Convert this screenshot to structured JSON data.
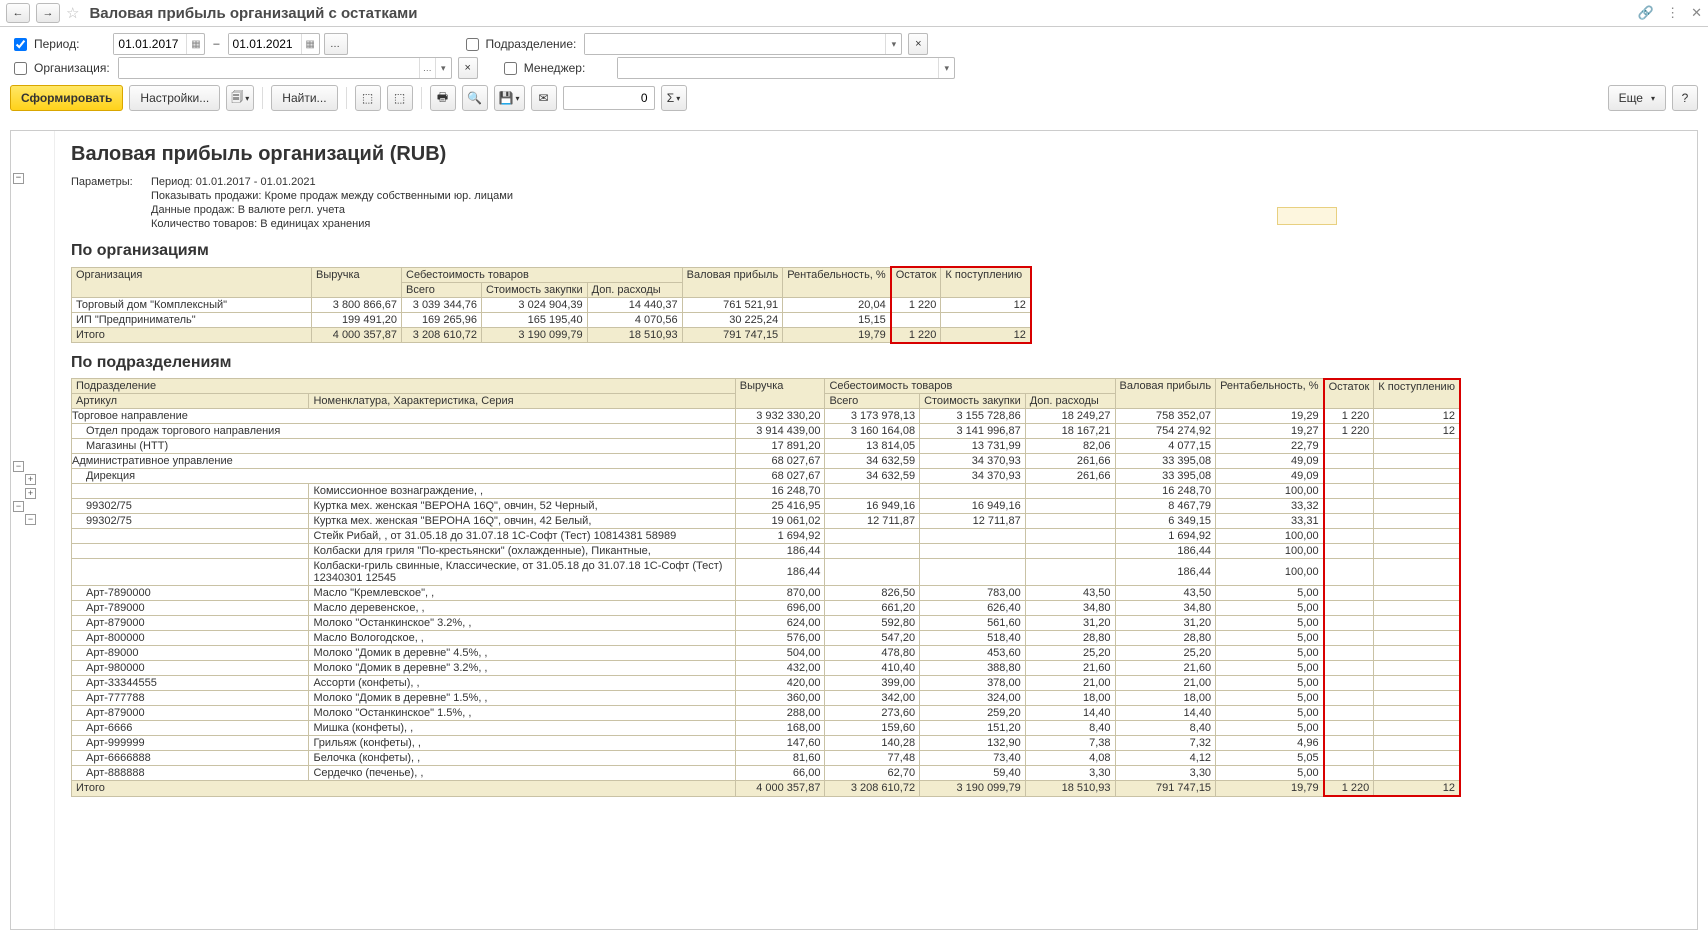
{
  "title": "Валовая прибыль организаций с остатками",
  "filters": {
    "period_label": "Период:",
    "date_from": "01.01.2017",
    "date_to": "01.01.2021",
    "org_label": "Организация:",
    "subdiv_label": "Подразделение:",
    "manager_label": "Менеджер:"
  },
  "toolbar": {
    "form": "Сформировать",
    "settings": "Настройки...",
    "find": "Найти...",
    "more": "Еще",
    "num": "0"
  },
  "report": {
    "title": "Валовая прибыль организаций (RUB)",
    "params_label": "Параметры:",
    "params": [
      "Период: 01.01.2017 - 01.01.2021",
      "Показывать продажи: Кроме продаж между собственными юр. лицами",
      "Данные продаж: В валюте регл. учета",
      "Количество товаров: В единицах хранения"
    ],
    "sec1": "По организациям",
    "sec2": "По подразделениям"
  },
  "t1": {
    "headers": {
      "org": "Организация",
      "rev": "Выручка",
      "cost": "Себестоимость товаров",
      "total": "Всего",
      "purch": "Стоимость закупки",
      "extra": "Доп. расходы",
      "gross": "Валовая прибыль",
      "rent": "Рентабельность, %",
      "stock": "Остаток",
      "incoming": "К поступлению"
    },
    "rows": [
      {
        "org": "Торговый дом \"Комплексный\"",
        "rev": "3 800 866,67",
        "total": "3 039 344,76",
        "purch": "3 024 904,39",
        "extra": "14 440,37",
        "gross": "761 521,91",
        "rent": "20,04",
        "stock": "1 220",
        "inc": "12"
      },
      {
        "org": "ИП \"Предприниматель\"",
        "rev": "199 491,20",
        "total": "169 265,96",
        "purch": "165 195,40",
        "extra": "4 070,56",
        "gross": "30 225,24",
        "rent": "15,15",
        "stock": "",
        "inc": ""
      }
    ],
    "total": {
      "label": "Итого",
      "rev": "4 000 357,87",
      "total": "3 208 610,72",
      "purch": "3 190 099,79",
      "extra": "18 510,93",
      "gross": "791 747,15",
      "rent": "19,79",
      "stock": "1 220",
      "inc": "12"
    }
  },
  "t2": {
    "headers": {
      "subdiv": "Подразделение",
      "art": "Артикул",
      "nom": "Номенклатура, Характеристика, Серия",
      "rev": "Выручка",
      "cost": "Себестоимость товаров",
      "total": "Всего",
      "purch": "Стоимость закупки",
      "extra": "Доп. расходы",
      "gross": "Валовая прибыль",
      "rent": "Рентабельность, %",
      "stock": "Остаток",
      "inc": "К поступлению"
    },
    "rows": [
      {
        "ind": 0,
        "a": "Торговое направление",
        "b": "",
        "r": "3 932 330,20",
        "t": "3 173 978,13",
        "p": "3 155 728,86",
        "e": "18 249,27",
        "g": "758 352,07",
        "n": "19,29",
        "s": "1 220",
        "i": "12"
      },
      {
        "ind": 1,
        "a": "Отдел продаж торгового направления",
        "b": "",
        "r": "3 914 439,00",
        "t": "3 160 164,08",
        "p": "3 141 996,87",
        "e": "18 167,21",
        "g": "754 274,92",
        "n": "19,27",
        "s": "1 220",
        "i": "12"
      },
      {
        "ind": 1,
        "a": "Магазины (НТТ)",
        "b": "",
        "r": "17 891,20",
        "t": "13 814,05",
        "p": "13 731,99",
        "e": "82,06",
        "g": "4 077,15",
        "n": "22,79",
        "s": "",
        "i": ""
      },
      {
        "ind": 0,
        "a": "Административное управление",
        "b": "",
        "r": "68 027,67",
        "t": "34 632,59",
        "p": "34 370,93",
        "e": "261,66",
        "g": "33 395,08",
        "n": "49,09",
        "s": "",
        "i": ""
      },
      {
        "ind": 1,
        "a": "Дирекция",
        "b": "",
        "r": "68 027,67",
        "t": "34 632,59",
        "p": "34 370,93",
        "e": "261,66",
        "g": "33 395,08",
        "n": "49,09",
        "s": "",
        "i": ""
      },
      {
        "ind": 2,
        "a": "",
        "b": "Комиссионное вознаграждение, ,",
        "r": "16 248,70",
        "t": "",
        "p": "",
        "e": "",
        "g": "16 248,70",
        "n": "100,00",
        "s": "",
        "i": ""
      },
      {
        "ind": 2,
        "a": "99302/75",
        "b": "Куртка мех. женская \"ВЕРОНА 16Q\", овчин, 52 Черный,",
        "r": "25 416,95",
        "t": "16 949,16",
        "p": "16 949,16",
        "e": "",
        "g": "8 467,79",
        "n": "33,32",
        "s": "",
        "i": ""
      },
      {
        "ind": 2,
        "a": "99302/75",
        "b": "Куртка мех. женская \"ВЕРОНА 16Q\", овчин, 42 Белый,",
        "r": "19 061,02",
        "t": "12 711,87",
        "p": "12 711,87",
        "e": "",
        "g": "6 349,15",
        "n": "33,31",
        "s": "",
        "i": ""
      },
      {
        "ind": 2,
        "a": "",
        "b": "Стейк Рибай, , от 31.05.18 до 31.07.18 1С-Софт (Тест) 10814381 58989",
        "r": "1 694,92",
        "t": "",
        "p": "",
        "e": "",
        "g": "1 694,92",
        "n": "100,00",
        "s": "",
        "i": ""
      },
      {
        "ind": 2,
        "a": "",
        "b": "Колбаски для гриля \"По-крестьянски\" (охлажденные), Пикантные,",
        "r": "186,44",
        "t": "",
        "p": "",
        "e": "",
        "g": "186,44",
        "n": "100,00",
        "s": "",
        "i": ""
      },
      {
        "ind": 2,
        "a": "",
        "b": "Колбаски-гриль свинные, Классические, от 31.05.18 до 31.07.18 1С-Софт (Тест) 12340301 12545",
        "r": "186,44",
        "t": "",
        "p": "",
        "e": "",
        "g": "186,44",
        "n": "100,00",
        "s": "",
        "i": ""
      },
      {
        "ind": 2,
        "a": "Арт-7890000",
        "b": "Масло \"Кремлевское\", ,",
        "r": "870,00",
        "t": "826,50",
        "p": "783,00",
        "e": "43,50",
        "g": "43,50",
        "n": "5,00",
        "s": "",
        "i": ""
      },
      {
        "ind": 2,
        "a": "Арт-789000",
        "b": "Масло деревенское, ,",
        "r": "696,00",
        "t": "661,20",
        "p": "626,40",
        "e": "34,80",
        "g": "34,80",
        "n": "5,00",
        "s": "",
        "i": ""
      },
      {
        "ind": 2,
        "a": "Арт-879000",
        "b": "Молоко \"Останкинское\" 3.2%, ,",
        "r": "624,00",
        "t": "592,80",
        "p": "561,60",
        "e": "31,20",
        "g": "31,20",
        "n": "5,00",
        "s": "",
        "i": ""
      },
      {
        "ind": 2,
        "a": "Арт-800000",
        "b": "Масло Вологодское, ,",
        "r": "576,00",
        "t": "547,20",
        "p": "518,40",
        "e": "28,80",
        "g": "28,80",
        "n": "5,00",
        "s": "",
        "i": ""
      },
      {
        "ind": 2,
        "a": "Арт-89000",
        "b": "Молоко \"Домик в деревне\" 4.5%, ,",
        "r": "504,00",
        "t": "478,80",
        "p": "453,60",
        "e": "25,20",
        "g": "25,20",
        "n": "5,00",
        "s": "",
        "i": ""
      },
      {
        "ind": 2,
        "a": "Арт-980000",
        "b": "Молоко \"Домик в деревне\" 3.2%, ,",
        "r": "432,00",
        "t": "410,40",
        "p": "388,80",
        "e": "21,60",
        "g": "21,60",
        "n": "5,00",
        "s": "",
        "i": ""
      },
      {
        "ind": 2,
        "a": "Арт-33344555",
        "b": "Ассорти (конфеты), ,",
        "r": "420,00",
        "t": "399,00",
        "p": "378,00",
        "e": "21,00",
        "g": "21,00",
        "n": "5,00",
        "s": "",
        "i": ""
      },
      {
        "ind": 2,
        "a": "Арт-777788",
        "b": "Молоко \"Домик в деревне\" 1.5%, ,",
        "r": "360,00",
        "t": "342,00",
        "p": "324,00",
        "e": "18,00",
        "g": "18,00",
        "n": "5,00",
        "s": "",
        "i": ""
      },
      {
        "ind": 2,
        "a": "Арт-879000",
        "b": "Молоко \"Останкинское\" 1.5%, ,",
        "r": "288,00",
        "t": "273,60",
        "p": "259,20",
        "e": "14,40",
        "g": "14,40",
        "n": "5,00",
        "s": "",
        "i": ""
      },
      {
        "ind": 2,
        "a": "Арт-6666",
        "b": "Мишка (конфеты), ,",
        "r": "168,00",
        "t": "159,60",
        "p": "151,20",
        "e": "8,40",
        "g": "8,40",
        "n": "5,00",
        "s": "",
        "i": ""
      },
      {
        "ind": 2,
        "a": "Арт-999999",
        "b": "Грильяж (конфеты), ,",
        "r": "147,60",
        "t": "140,28",
        "p": "132,90",
        "e": "7,38",
        "g": "7,32",
        "n": "4,96",
        "s": "",
        "i": ""
      },
      {
        "ind": 2,
        "a": "Арт-6666888",
        "b": "Белочка (конфеты), ,",
        "r": "81,60",
        "t": "77,48",
        "p": "73,40",
        "e": "4,08",
        "g": "4,12",
        "n": "5,05",
        "s": "",
        "i": ""
      },
      {
        "ind": 2,
        "a": "Арт-888888",
        "b": "Сердечко (печенье), ,",
        "r": "66,00",
        "t": "62,70",
        "p": "59,40",
        "e": "3,30",
        "g": "3,30",
        "n": "5,00",
        "s": "",
        "i": ""
      }
    ],
    "total": {
      "label": "Итого",
      "r": "4 000 357,87",
      "t": "3 208 610,72",
      "p": "3 190 099,79",
      "e": "18 510,93",
      "g": "791 747,15",
      "n": "19,79",
      "s": "1 220",
      "i": "12"
    }
  }
}
